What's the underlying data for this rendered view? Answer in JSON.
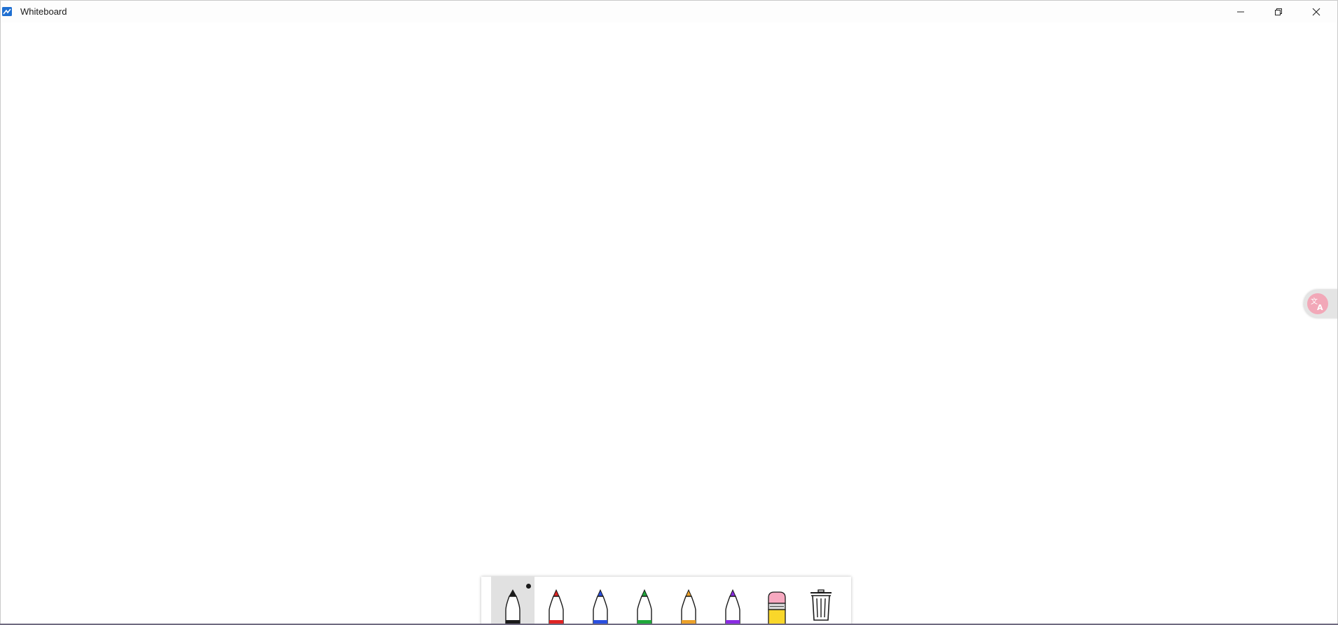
{
  "window": {
    "title": "Whiteboard",
    "app_icon": "whiteboard-app-icon",
    "controls": {
      "minimize_icon": "minimize-icon",
      "restore_icon": "restore-icon",
      "close_icon": "close-icon"
    }
  },
  "side_panel": {
    "icon": "translate-icon",
    "color": "#f2a8b8"
  },
  "toolbar": {
    "selected_tool": "black-pen",
    "tools": [
      {
        "name": "black-pen",
        "icon": "pen-icon",
        "color": "#1a1a1a"
      },
      {
        "name": "red-pen",
        "icon": "pen-icon",
        "color": "#e02424"
      },
      {
        "name": "blue-pen",
        "icon": "pen-icon",
        "color": "#2a4fe0"
      },
      {
        "name": "green-pen",
        "icon": "pen-icon",
        "color": "#1fa83a"
      },
      {
        "name": "orange-pen",
        "icon": "pen-icon",
        "color": "#eba12a"
      },
      {
        "name": "purple-pen",
        "icon": "pen-icon",
        "color": "#8a2be2"
      },
      {
        "name": "eraser",
        "icon": "eraser-icon",
        "color": "#f7a9c0"
      },
      {
        "name": "clear-all",
        "icon": "trash-icon",
        "color": "#1a1a1a"
      }
    ]
  },
  "colors": {
    "canvas_background": "#ffffff",
    "toolbar_selected": "#e1e1e1"
  }
}
